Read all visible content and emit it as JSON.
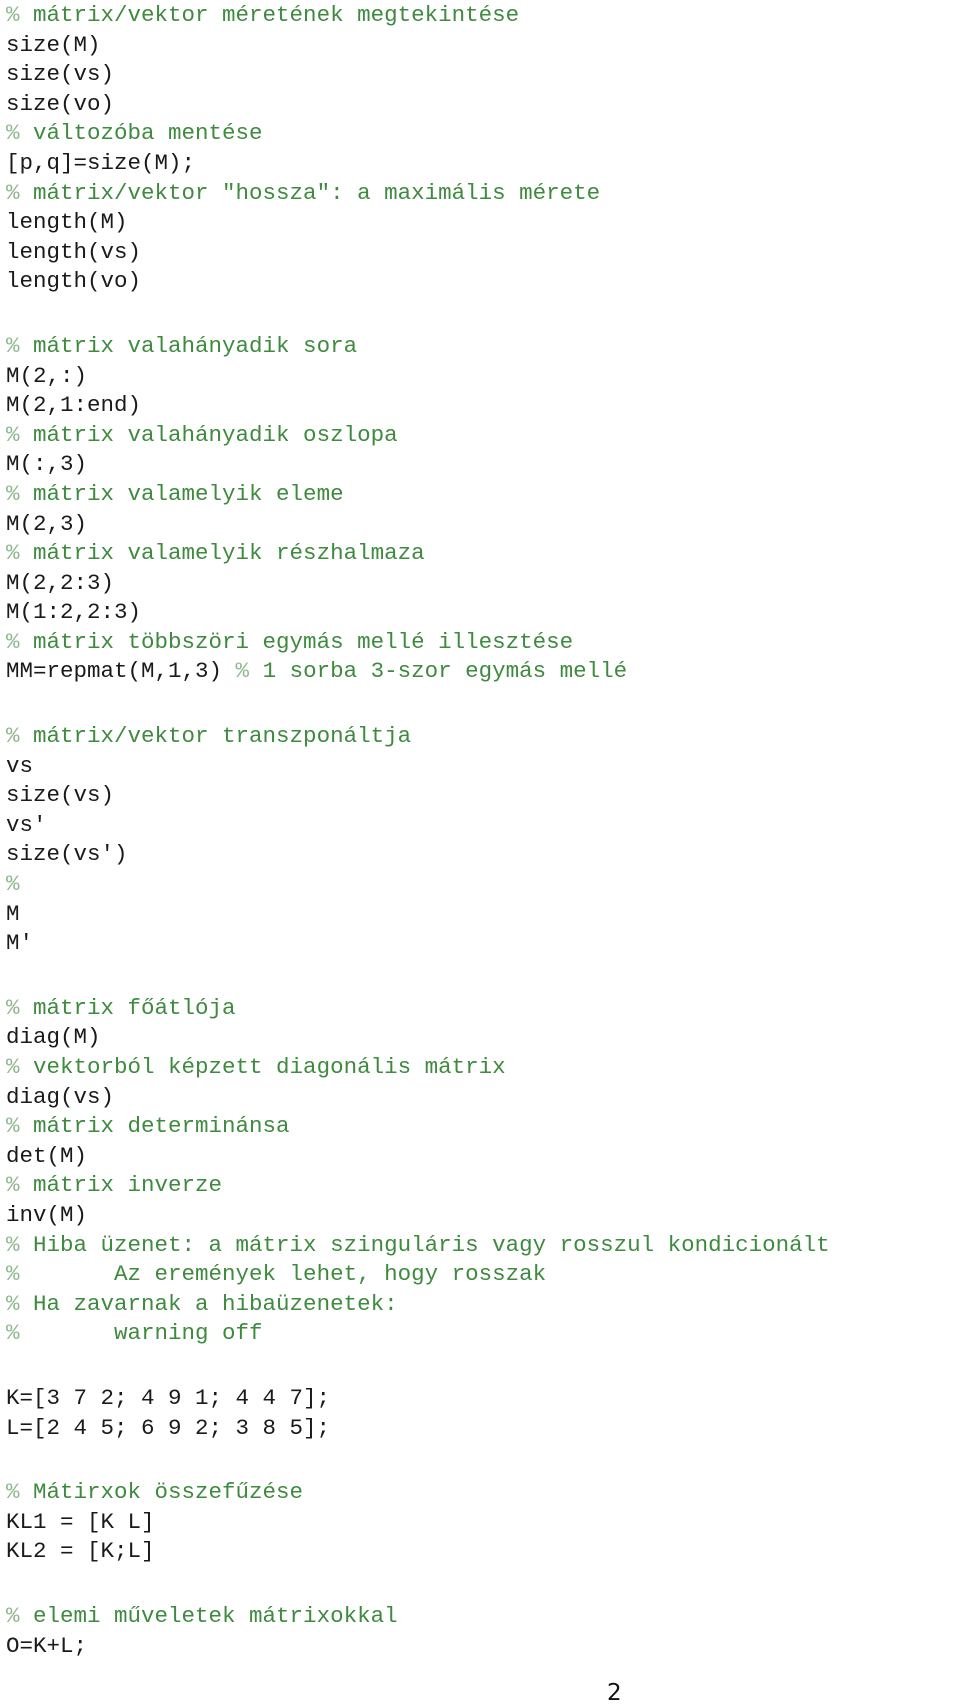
{
  "document": {
    "lines": [
      {
        "type": "comment",
        "text": " mátrix/vektor méretének megtekintése"
      },
      {
        "type": "code",
        "text": "size(M)"
      },
      {
        "type": "code",
        "text": "size(vs)"
      },
      {
        "type": "code",
        "text": "size(vo)"
      },
      {
        "type": "comment",
        "text": " változóba mentése"
      },
      {
        "type": "code",
        "text": "[p,q]=size(M);"
      },
      {
        "type": "comment",
        "text": " mátrix/vektor \"hossza\": a maximális mérete"
      },
      {
        "type": "code",
        "text": "length(M)"
      },
      {
        "type": "code",
        "text": "length(vs)"
      },
      {
        "type": "code",
        "text": "length(vo)"
      },
      {
        "type": "blank",
        "text": ""
      },
      {
        "type": "comment",
        "text": " mátrix valahányadik sora"
      },
      {
        "type": "code",
        "text": "M(2,:)"
      },
      {
        "type": "code",
        "text": "M(2,1:end)"
      },
      {
        "type": "comment",
        "text": " mátrix valahányadik oszlopa"
      },
      {
        "type": "code",
        "text": "M(:,3)"
      },
      {
        "type": "comment",
        "text": " mátrix valamelyik eleme"
      },
      {
        "type": "code",
        "text": "M(2,3)"
      },
      {
        "type": "comment",
        "text": " mátrix valamelyik részhalmaza"
      },
      {
        "type": "code",
        "text": "M(2,2:3)"
      },
      {
        "type": "code",
        "text": "M(1:2,2:3)"
      },
      {
        "type": "comment",
        "text": " mátrix többszöri egymás mellé illesztése"
      },
      {
        "type": "mixed",
        "text": "MM=repmat(M,1,3) ",
        "comment": " 1 sorba 3-szor egymás mellé"
      },
      {
        "type": "blank",
        "text": ""
      },
      {
        "type": "comment",
        "text": " mátrix/vektor transzponáltja"
      },
      {
        "type": "code",
        "text": "vs"
      },
      {
        "type": "code",
        "text": "size(vs)"
      },
      {
        "type": "code",
        "text": "vs'"
      },
      {
        "type": "code",
        "text": "size(vs')"
      },
      {
        "type": "comment",
        "text": ""
      },
      {
        "type": "code",
        "text": "M"
      },
      {
        "type": "code",
        "text": "M'"
      },
      {
        "type": "blank",
        "text": ""
      },
      {
        "type": "comment",
        "text": " mátrix főátlója"
      },
      {
        "type": "code",
        "text": "diag(M)"
      },
      {
        "type": "comment",
        "text": " vektorból képzett diagonális mátrix"
      },
      {
        "type": "code",
        "text": "diag(vs)"
      },
      {
        "type": "comment",
        "text": " mátrix determinánsa"
      },
      {
        "type": "code",
        "text": "det(M)"
      },
      {
        "type": "comment",
        "text": " mátrix inverze"
      },
      {
        "type": "code",
        "text": "inv(M)"
      },
      {
        "type": "comment",
        "text": " Hiba üzenet: a mátrix szinguláris vagy rosszul kondicionált"
      },
      {
        "type": "comment",
        "text": "       Az eremények lehet, hogy rosszak"
      },
      {
        "type": "comment",
        "text": " Ha zavarnak a hibaüzenetek:"
      },
      {
        "type": "comment",
        "text": "       warning off"
      },
      {
        "type": "blank",
        "text": ""
      },
      {
        "type": "code",
        "text": "K=[3 7 2; 4 9 1; 4 4 7];"
      },
      {
        "type": "code",
        "text": "L=[2 4 5; 6 9 2; 3 8 5];"
      },
      {
        "type": "blank",
        "text": ""
      },
      {
        "type": "comment",
        "text": " Mátirxok összefűzése"
      },
      {
        "type": "code",
        "text": "KL1 = [K L]"
      },
      {
        "type": "code",
        "text": "KL2 = [K;L]"
      },
      {
        "type": "blank",
        "text": ""
      },
      {
        "type": "comment",
        "text": " elemi műveletek mátrixokkal"
      },
      {
        "type": "code",
        "text": "O=K+L;"
      }
    ],
    "comment_marker": "%",
    "page_number": "2"
  },
  "colors": {
    "code": "#1a1a1a",
    "comment": "#3e8a3e",
    "comment_marker": "#8fb88f",
    "background": "#ffffff"
  }
}
